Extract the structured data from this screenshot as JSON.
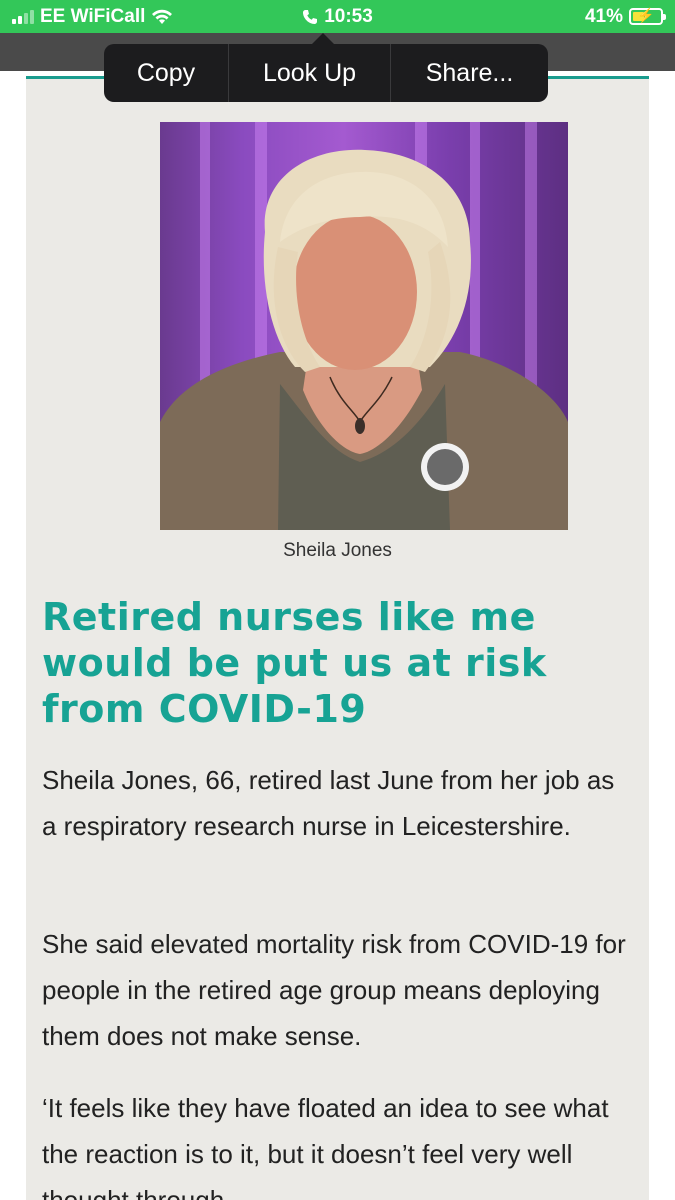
{
  "status_bar": {
    "carrier": "EE WiFiCall",
    "time": "10:53",
    "battery_percent": "41%",
    "battery_level": 0.41,
    "colors": {
      "background": "#33c759"
    }
  },
  "context_menu": {
    "copy_label": "Copy",
    "lookup_label": "Look Up",
    "share_label": "Share..."
  },
  "article": {
    "image_caption": "Sheila Jones",
    "headline": "Retired nurses like me would be put us at risk from COVID-19",
    "paragraphs": [
      "Sheila Jones, 66, retired last June from her job as a respiratory research nurse in Leicestershire.",
      "She said elevated mortality risk from COVID-19 for people in the retired age group means deploying them does not make sense.",
      "‘It feels like they have floated an idea to see what the reaction is to it, but it doesn’t feel very well thought through."
    ],
    "colors": {
      "headline": "#17a394",
      "card_background": "#ebeae6"
    }
  }
}
